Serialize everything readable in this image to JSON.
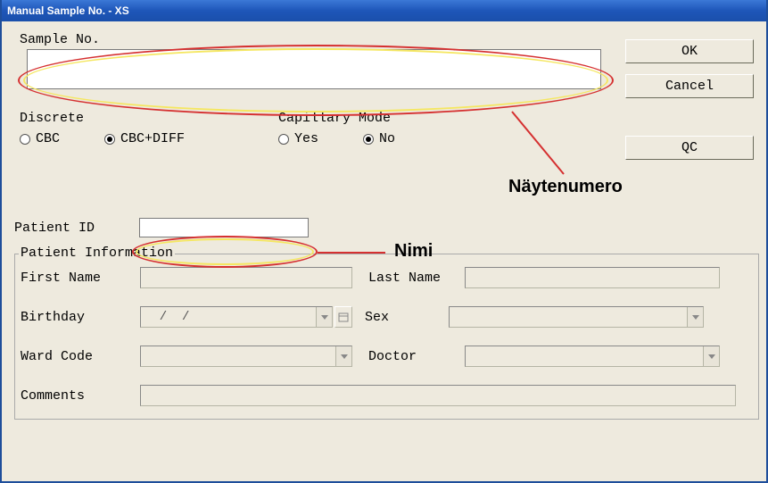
{
  "window": {
    "title": "Manual Sample No. - XS"
  },
  "buttons": {
    "ok": "OK",
    "cancel": "Cancel",
    "qc": "QC"
  },
  "sample": {
    "label": "Sample No.",
    "value": ""
  },
  "discrete": {
    "title": "Discrete",
    "cbc": "CBC",
    "cbcdiff": "CBC+DIFF",
    "selected": "CBC+DIFF"
  },
  "capillary": {
    "title": "Capillary Mode",
    "yes": "Yes",
    "no": "No",
    "selected": "No"
  },
  "patientId": {
    "label": "Patient ID",
    "value": ""
  },
  "patientInfo": {
    "legend": "Patient Information",
    "firstNameLabel": "First Name",
    "firstName": "",
    "lastNameLabel": "Last Name",
    "lastName": "",
    "birthdayLabel": "Birthday",
    "birthday": "  /  /",
    "sexLabel": "Sex",
    "sex": "",
    "wardLabel": "Ward Code",
    "ward": "",
    "doctorLabel": "Doctor",
    "doctor": "",
    "commentsLabel": "Comments",
    "comments": ""
  },
  "annotations": {
    "naytenumero": "Näytenumero",
    "nimi": "Nimi"
  }
}
